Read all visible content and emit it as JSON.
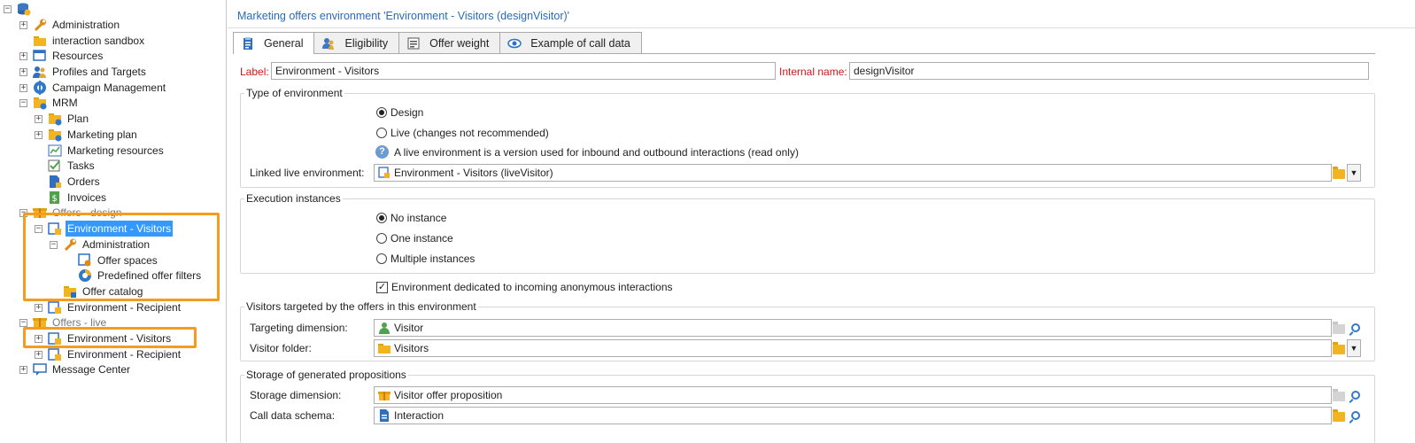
{
  "tree": {
    "items": [
      {
        "label": "",
        "icon": "database-icon",
        "toggle": "minus"
      },
      {
        "label": "Administration",
        "icon": "wrench-icon",
        "toggle": "plus"
      },
      {
        "label": "interaction sandbox",
        "icon": "folder-icon",
        "toggle": "none"
      },
      {
        "label": "Resources",
        "icon": "resources-icon",
        "toggle": "plus"
      },
      {
        "label": "Profiles and Targets",
        "icon": "profiles-icon",
        "toggle": "plus"
      },
      {
        "label": "Campaign Management",
        "icon": "campaign-icon",
        "toggle": "plus"
      },
      {
        "label": "MRM",
        "icon": "mrm-folder-icon",
        "toggle": "minus"
      },
      {
        "label": "Plan",
        "icon": "plan-folder-icon",
        "toggle": "plus"
      },
      {
        "label": "Marketing plan",
        "icon": "plan-folder-icon",
        "toggle": "plus"
      },
      {
        "label": "Marketing resources",
        "icon": "chart-icon",
        "toggle": "none"
      },
      {
        "label": "Tasks",
        "icon": "tasks-icon",
        "toggle": "none"
      },
      {
        "label": "Orders",
        "icon": "orders-icon",
        "toggle": "none"
      },
      {
        "label": "Invoices",
        "icon": "invoice-icon",
        "toggle": "none"
      },
      {
        "label": "Offers - design",
        "icon": "offers-folder-icon",
        "toggle": "minus"
      },
      {
        "label": "Environment - Visitors",
        "icon": "environment-icon",
        "toggle": "minus"
      },
      {
        "label": "Administration",
        "icon": "wrench-icon",
        "toggle": "minus"
      },
      {
        "label": "Offer spaces",
        "icon": "offer-space-icon",
        "toggle": "none"
      },
      {
        "label": "Predefined offer filters",
        "icon": "filter-icon",
        "toggle": "none"
      },
      {
        "label": "Offer catalog",
        "icon": "catalog-folder-icon",
        "toggle": "none"
      },
      {
        "label": "Environment - Recipient",
        "icon": "environment-icon",
        "toggle": "plus"
      },
      {
        "label": "Offers - live",
        "icon": "offers-folder-icon",
        "toggle": "minus"
      },
      {
        "label": "Environment - Visitors",
        "icon": "environment-icon",
        "toggle": "plus"
      },
      {
        "label": "Environment - Recipient",
        "icon": "environment-icon",
        "toggle": "plus"
      },
      {
        "label": "Message Center",
        "icon": "message-center-icon",
        "toggle": "plus"
      }
    ]
  },
  "header": {
    "title": "Marketing offers environment 'Environment - Visitors (designVisitor)'"
  },
  "tabs": [
    {
      "label": "General",
      "icon": "clipboard-icon"
    },
    {
      "label": "Eligibility",
      "icon": "users-icon"
    },
    {
      "label": "Offer weight",
      "icon": "weight-icon"
    },
    {
      "label": "Example of call data",
      "icon": "eye-icon"
    }
  ],
  "form": {
    "label_caption": "Label:",
    "label_value": "Environment - Visitors",
    "internal_name_caption": "Internal name:",
    "internal_name_value": "designVisitor",
    "type_legend": "Type of environment",
    "type_design": "Design",
    "type_live": "Live (changes not recommended)",
    "type_info": "A live environment is a version used for inbound and outbound interactions (read only)",
    "linked_caption": "Linked live environment:",
    "linked_value": "Environment - Visitors (liveVisitor)",
    "exec_legend": "Execution instances",
    "exec_none": "No instance",
    "exec_one": "One instance",
    "exec_multiple": "Multiple instances",
    "anon_check": "Environment dedicated to incoming anonymous interactions",
    "visitors_legend": "Visitors targeted by the offers in this environment",
    "targeting_caption": "Targeting dimension:",
    "targeting_value": "Visitor",
    "visitor_folder_caption": "Visitor folder:",
    "visitor_folder_value": "Visitors",
    "storage_legend": "Storage of generated propositions",
    "storage_caption": "Storage dimension:",
    "storage_value": "Visitor offer proposition",
    "call_schema_caption": "Call data schema:",
    "call_schema_value": "Interaction"
  },
  "colors": {
    "highlight": "#f39c1f",
    "selection": "#3399ff",
    "required": "#d4161b",
    "header_text": "#2a6ab6"
  }
}
